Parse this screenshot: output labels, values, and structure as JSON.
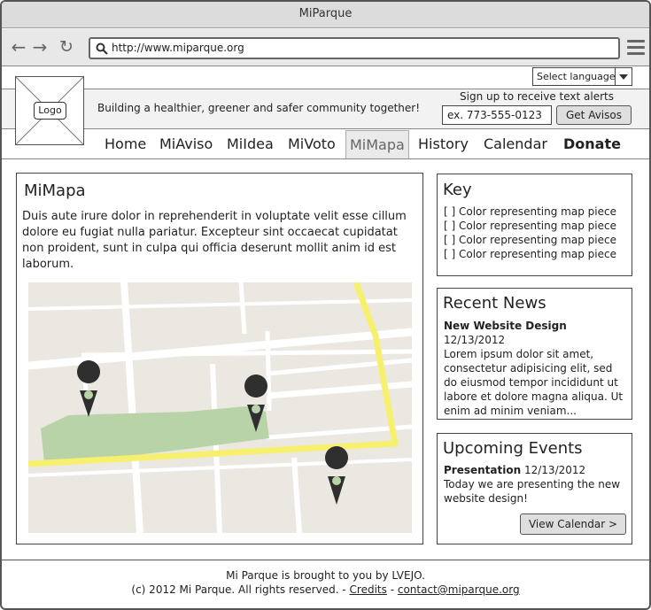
{
  "window": {
    "title": "MiParque"
  },
  "browser": {
    "url": "http://www.miparque.org"
  },
  "header": {
    "language_select": "Select language",
    "logo_label": "Logo",
    "tagline": "Building a healthier, greener and safer community together!",
    "signup_label": "Sign up to receive text alerts",
    "phone_placeholder": "ex. 773-555-0123",
    "get_button": "Get Avisos"
  },
  "nav": {
    "items": [
      "Home",
      "MiAviso",
      "MiIdea",
      "MiVoto",
      "MiMapa",
      "History",
      "Calendar",
      "Donate"
    ],
    "active": "MiMapa"
  },
  "main": {
    "title": "MiMapa",
    "body": "Duis aute irure dolor in reprehenderit in voluptate velit esse cillum dolore eu fugiat nulla pariatur. Excepteur sint occaecat cupidatat non proident, sunt in culpa qui officia deserunt mollit anim id est laborum.",
    "map": {
      "icon": "map-pin-icon",
      "pins": 3
    }
  },
  "key": {
    "title": "Key",
    "items": [
      "[ ] Color representing map piece",
      "[ ] Color representing map piece",
      "[ ] Color representing map piece",
      "[ ] Color representing map piece"
    ]
  },
  "news": {
    "title": "Recent News",
    "headline": "New Website Design",
    "date": "12/13/2012",
    "text": "Lorem ipsum dolor sit amet, consectetur adipisicing elit, sed do eiusmod tempor incididunt ut labore et dolore magna aliqua. Ut enim ad minim veniam..."
  },
  "events": {
    "title": "Upcoming Events",
    "event_name": "Presentation",
    "date": "12/13/2012",
    "text": "Today we are presenting the new website design!",
    "button": "View Calendar >"
  },
  "footer": {
    "line1": "Mi Parque is brought to you by LVEJO.",
    "copyright": "(c) 2012 Mi Parque. All rights reserved. -",
    "credits": "Credits",
    "sep": "-",
    "contact": "contact@miparque.org"
  },
  "colors": {
    "road_major": "#f7f06e",
    "park": "#b9d3a8",
    "map_bg": "#ebe8e2",
    "pin": "#2f2f2f"
  }
}
